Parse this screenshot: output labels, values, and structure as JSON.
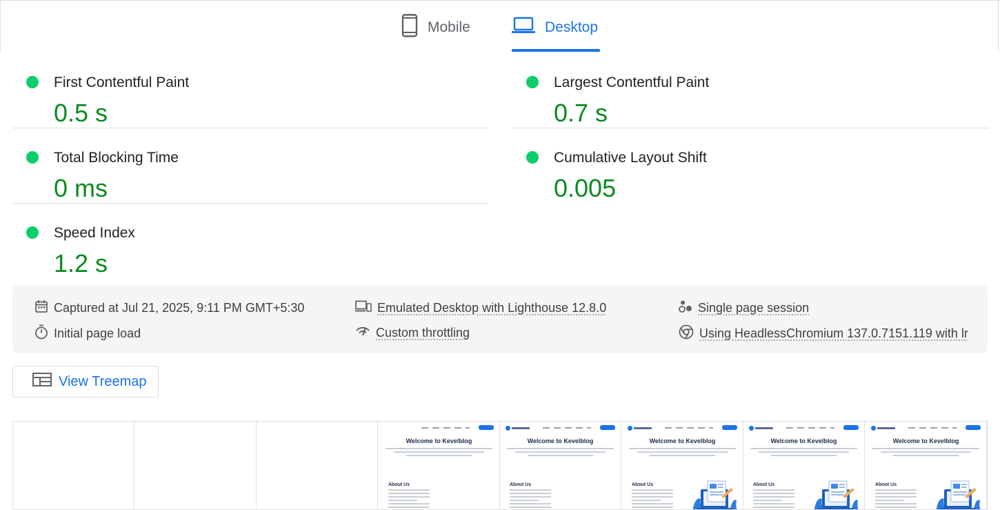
{
  "tabs": [
    {
      "label": "Mobile",
      "icon": "mobile-icon",
      "active": false
    },
    {
      "label": "Desktop",
      "icon": "laptop-icon",
      "active": true
    }
  ],
  "colors": {
    "accent": "#1a73e8",
    "pass": "#0cce6b",
    "value": "#0a8a1e"
  },
  "metrics": [
    {
      "label": "First Contentful Paint",
      "value": "0.5 s",
      "status": "pass"
    },
    {
      "label": "Largest Contentful Paint",
      "value": "0.7 s",
      "status": "pass"
    },
    {
      "label": "Total Blocking Time",
      "value": "0 ms",
      "status": "pass"
    },
    {
      "label": "Cumulative Layout Shift",
      "value": "0.005",
      "status": "pass"
    },
    {
      "label": "Speed Index",
      "value": "1.2 s",
      "status": "pass"
    }
  ],
  "info": {
    "captured": "Captured at Jul 21, 2025, 9:11 PM GMT+5:30",
    "initial_load": "Initial page load",
    "emulated": "Emulated Desktop with Lighthouse 12.8.0",
    "throttling": "Custom throttling",
    "session": "Single page session",
    "browser": "Using HeadlessChromium 137.0.7151.119 with lr"
  },
  "treemap": {
    "label": "View Treemap",
    "icon": "treemap-icon"
  },
  "filmstrip": {
    "frame_title": "Welcome to Kevelblog",
    "about_heading": "About Us",
    "frames": [
      {
        "state": "blank"
      },
      {
        "state": "blank"
      },
      {
        "state": "blank"
      },
      {
        "state": "text"
      },
      {
        "state": "text"
      },
      {
        "state": "full"
      },
      {
        "state": "full"
      },
      {
        "state": "full"
      }
    ]
  }
}
